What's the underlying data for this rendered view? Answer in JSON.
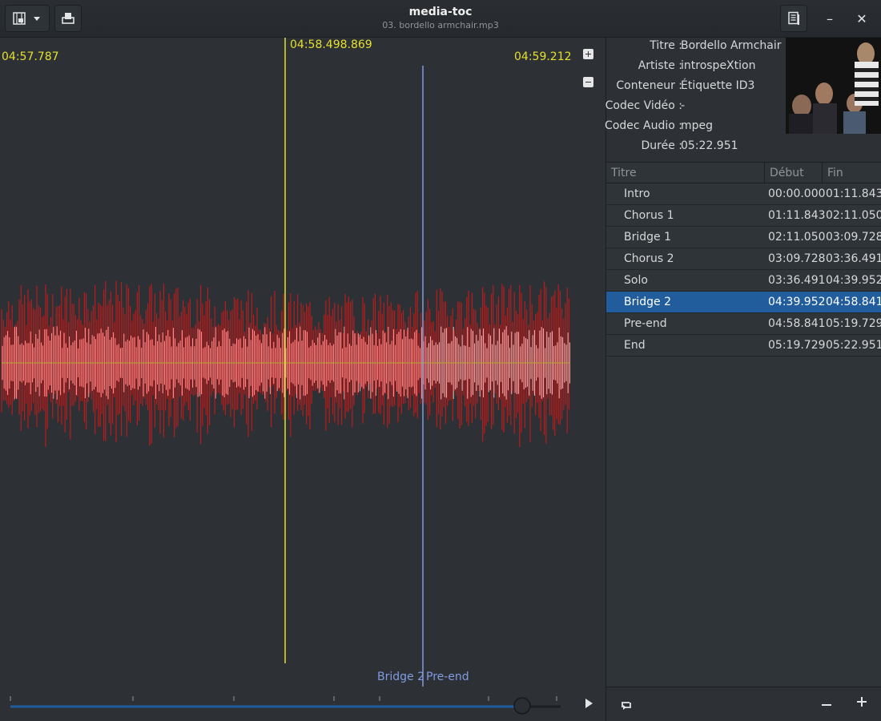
{
  "window": {
    "title": "media-toc",
    "subtitle": "03. bordello armchair.mp3",
    "minimize_label": "–",
    "close_label": "✕"
  },
  "waveform": {
    "start_time": "04:57.787",
    "cursor_time": "04:58.498.869",
    "end_time": "04:59.212",
    "chapter_left": "Bridge 2",
    "chapter_right": "Pre-end",
    "playback_position": 0.93
  },
  "info": {
    "rows": [
      {
        "key": "Titre :",
        "value": "Bordello Armchair"
      },
      {
        "key": "Artiste :",
        "value": "introspeXtion"
      },
      {
        "key": "Conteneur :",
        "value": "Étiquette ID3"
      },
      {
        "key": "Codec Vidéo :",
        "value": "-"
      },
      {
        "key": "Codec Audio :",
        "value": "mpeg"
      },
      {
        "key": "Durée :",
        "value": "05:22.951"
      }
    ]
  },
  "chapters": {
    "headers": {
      "title": "Titre",
      "start": "Début",
      "end": "Fin"
    },
    "rows": [
      {
        "title": "Intro",
        "start": "00:00.000",
        "end": "01:11.843"
      },
      {
        "title": "Chorus 1",
        "start": "01:11.843",
        "end": "02:11.050"
      },
      {
        "title": "Bridge 1",
        "start": "02:11.050",
        "end": "03:09.728"
      },
      {
        "title": "Chorus 2",
        "start": "03:09.728",
        "end": "03:36.491"
      },
      {
        "title": "Solo",
        "start": "03:36.491",
        "end": "04:39.952"
      },
      {
        "title": "Bridge 2",
        "start": "04:39.952",
        "end": "04:58.841"
      },
      {
        "title": "Pre-end",
        "start": "04:58.841",
        "end": "05:19.729"
      },
      {
        "title": "End",
        "start": "05:19.729",
        "end": "05:22.951"
      }
    ],
    "selected_index": 5
  },
  "colors": {
    "cursor": "#e5e02e",
    "chapter_marker": "#7f9ce0",
    "waveform_left": "#b81c1c",
    "waveform_right": "#f0a0a0",
    "selection": "#215d9c"
  }
}
